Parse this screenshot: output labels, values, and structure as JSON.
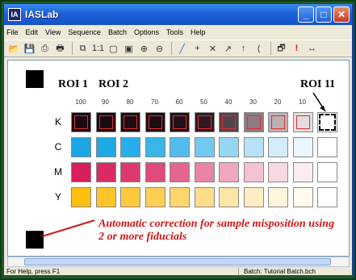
{
  "window": {
    "title": "IASLab",
    "app_icon_text": "IA"
  },
  "title_buttons": {
    "minimize": "_",
    "maximize": "□",
    "close": "✕"
  },
  "menu": [
    "File",
    "Edit",
    "View",
    "Sequence",
    "Batch",
    "Options",
    "Tools",
    "Help"
  ],
  "toolbar": [
    {
      "icon": "open-icon",
      "glyph": "📂"
    },
    {
      "icon": "save-icon",
      "glyph": "💾"
    },
    {
      "icon": "preview-icon",
      "glyph": "⎙"
    },
    {
      "icon": "print-icon",
      "glyph": "🖶"
    },
    {
      "icon": "copy-icon",
      "glyph": "⧉"
    },
    {
      "icon": "one-to-one-icon",
      "glyph": "1:1"
    },
    {
      "icon": "frame-icon",
      "glyph": "▢"
    },
    {
      "icon": "frame-fill-icon",
      "glyph": "▣"
    },
    {
      "icon": "zoom-in-icon",
      "glyph": "⊕"
    },
    {
      "icon": "zoom-out-icon",
      "glyph": "⊖"
    },
    {
      "icon": "line-tool-icon",
      "glyph": "╱"
    },
    {
      "icon": "plus-icon",
      "glyph": "+"
    },
    {
      "icon": "cross-icon",
      "glyph": "✕"
    },
    {
      "icon": "arrow-up-right-icon",
      "glyph": "↗"
    },
    {
      "icon": "arrow-up-icon",
      "glyph": "↑"
    },
    {
      "icon": "bracket-icon",
      "glyph": "⟨"
    },
    {
      "icon": "properties-icon",
      "glyph": "🗗"
    },
    {
      "icon": "alert-icon",
      "glyph": "!"
    },
    {
      "icon": "arrows-horizontal-icon",
      "glyph": "↔"
    }
  ],
  "image": {
    "roi_labels": [
      "ROI 1",
      "ROI 2",
      "ROI 11"
    ],
    "columns": [
      "100",
      "90",
      "80",
      "70",
      "60",
      "50",
      "40",
      "30",
      "20",
      "10",
      ""
    ],
    "rows": [
      {
        "label": "K",
        "colors": [
          "#1a0a12",
          "#1a0a12",
          "#1c0c14",
          "#1d0e16",
          "#231119",
          "#2d1a22",
          "#55434a",
          "#8a7c82",
          "#b9b0b4",
          "#e2ddde",
          "#ffffff"
        ]
      },
      {
        "label": "C",
        "colors": [
          "#1aa6e2",
          "#1fa9e3",
          "#29adea",
          "#3ab5ea",
          "#52bdec",
          "#72c9ef",
          "#96d6f2",
          "#b7e2f5",
          "#d2ecf8",
          "#eaf6fb",
          "#ffffff"
        ]
      },
      {
        "label": "M",
        "colors": [
          "#d81e5b",
          "#da2a63",
          "#dc3a6e",
          "#df4c7c",
          "#e46690",
          "#e984a8",
          "#efa6c0",
          "#f3c1d4",
          "#f7d8e4",
          "#fbecf2",
          "#ffffff"
        ]
      },
      {
        "label": "Y",
        "colors": [
          "#fdc010",
          "#fec52a",
          "#fec93c",
          "#fecf55",
          "#fed66e",
          "#fedd8a",
          "#fee5a8",
          "#ffedc4",
          "#fff4dc",
          "#fffaee",
          "#ffffff"
        ]
      }
    ]
  },
  "annotation": "Automatic correction for sample misposition using 2 or more fiducials",
  "status": {
    "left": "For Help, press F1",
    "right": "Batch: Tutorial Batch.bch"
  },
  "colors": {
    "annotation_red": "#d01818",
    "titlebar_blue": "#1d62d8"
  }
}
